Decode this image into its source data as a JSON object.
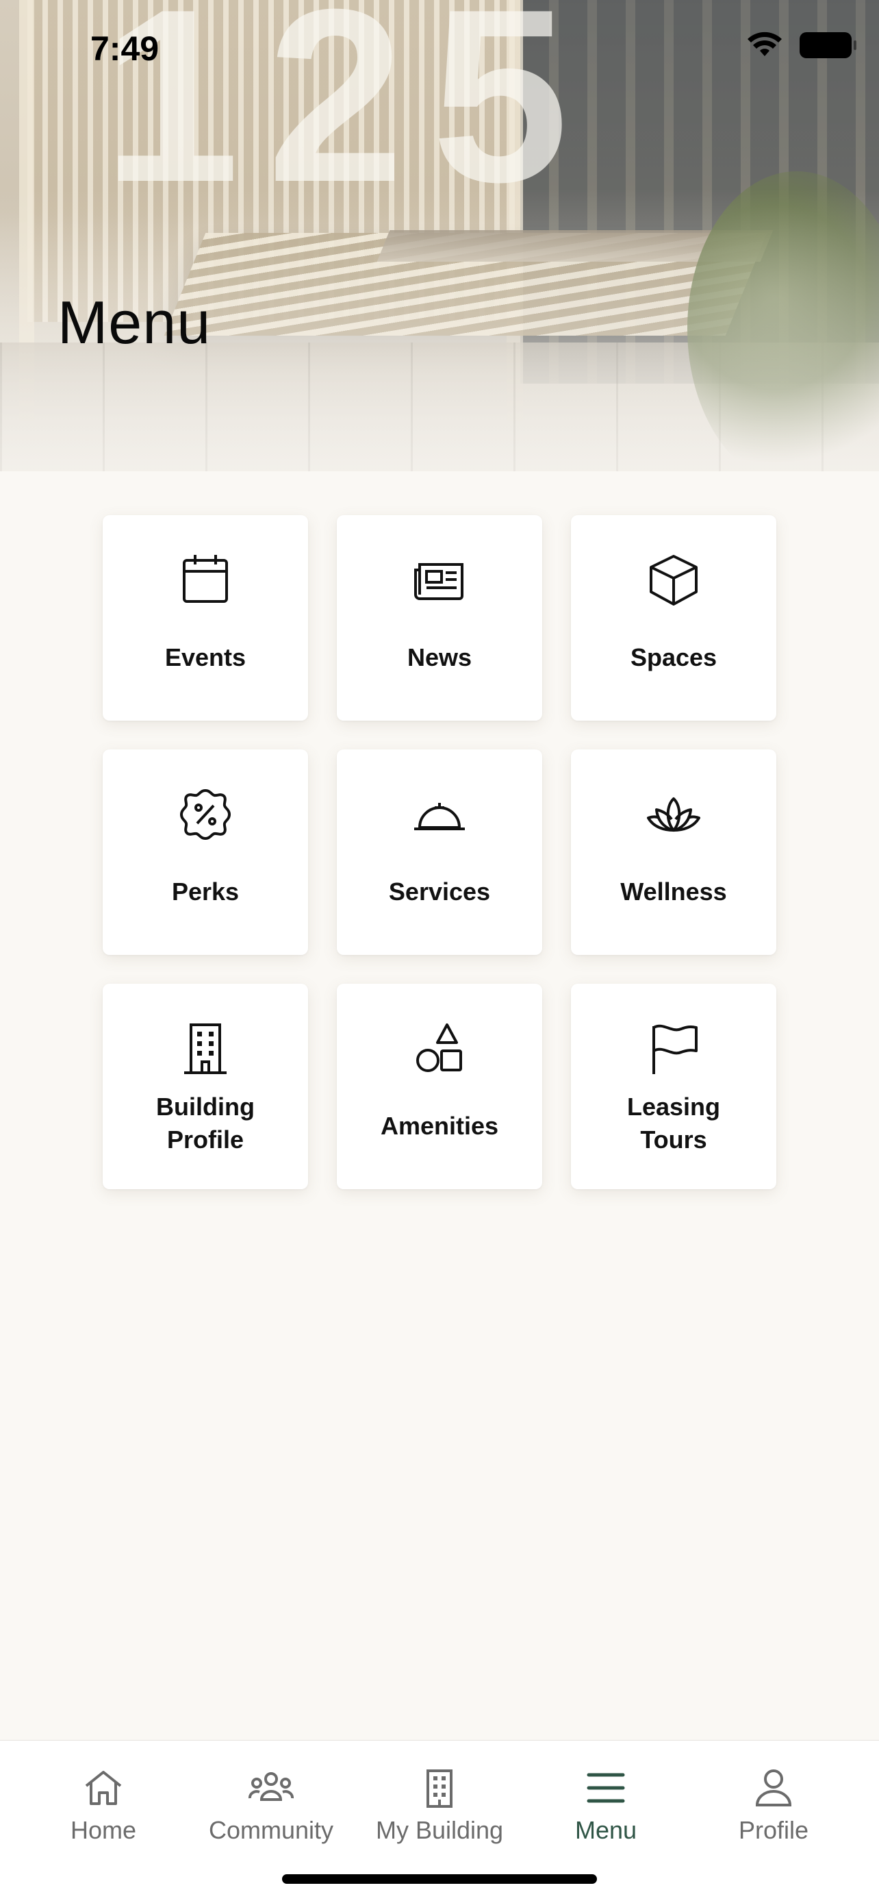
{
  "status_bar": {
    "time": "7:49"
  },
  "header": {
    "title": "Menu"
  },
  "menu_items": [
    {
      "label": "Events",
      "icon": "calendar-icon"
    },
    {
      "label": "News",
      "icon": "newspaper-icon"
    },
    {
      "label": "Spaces",
      "icon": "cube-icon"
    },
    {
      "label": "Perks",
      "icon": "percent-badge-icon"
    },
    {
      "label": "Services",
      "icon": "service-bell-icon"
    },
    {
      "label": "Wellness",
      "icon": "lotus-icon"
    },
    {
      "label": "Building\nProfile",
      "line1": "Building",
      "line2": "Profile",
      "icon": "building-icon"
    },
    {
      "label": "Amenities",
      "icon": "shapes-icon"
    },
    {
      "label": "Leasing\nTours",
      "line1": "Leasing",
      "line2": "Tours",
      "icon": "flag-icon"
    }
  ],
  "tabbar": {
    "items": [
      {
        "label": "Home",
        "icon": "home-icon",
        "active": false
      },
      {
        "label": "Community",
        "icon": "community-icon",
        "active": false
      },
      {
        "label": "My Building",
        "icon": "building-icon",
        "active": false
      },
      {
        "label": "Menu",
        "icon": "menu-icon",
        "active": true
      },
      {
        "label": "Profile",
        "icon": "person-icon",
        "active": false
      }
    ]
  },
  "colors": {
    "background": "#FAF8F4",
    "tile": "#FFFFFF",
    "active_tab": "#2F5546",
    "inactive_tab": "#6B6B6B"
  }
}
